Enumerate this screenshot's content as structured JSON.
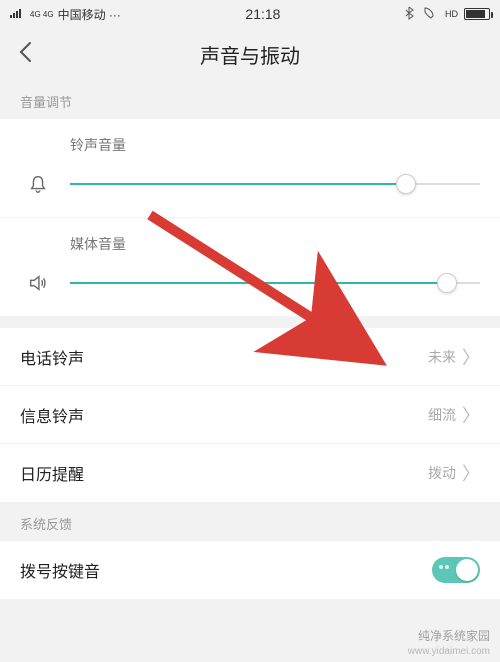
{
  "status": {
    "signal_tech": "4G 4G",
    "carrier": "中国移动 ···",
    "time": "21:18",
    "hd_label": "HD"
  },
  "header": {
    "title": "声音与振动"
  },
  "sections": {
    "volume_label": "音量调节",
    "feedback_label": "系统反馈"
  },
  "sliders": {
    "ringtone": {
      "label": "铃声音量",
      "percent": 82
    },
    "media": {
      "label": "媒体音量",
      "percent": 92
    }
  },
  "items": {
    "phone_ringtone": {
      "label": "电话铃声",
      "value": "未来"
    },
    "sms_ringtone": {
      "label": "信息铃声",
      "value": "细流"
    },
    "calendar": {
      "label": "日历提醒",
      "value": "拨动"
    },
    "dialpad": {
      "label": "拨号按键音"
    }
  },
  "watermark": {
    "text": "纯净系统家园",
    "url": "www.yidaimei.com"
  },
  "colors": {
    "accent": "#2fb8a8"
  }
}
